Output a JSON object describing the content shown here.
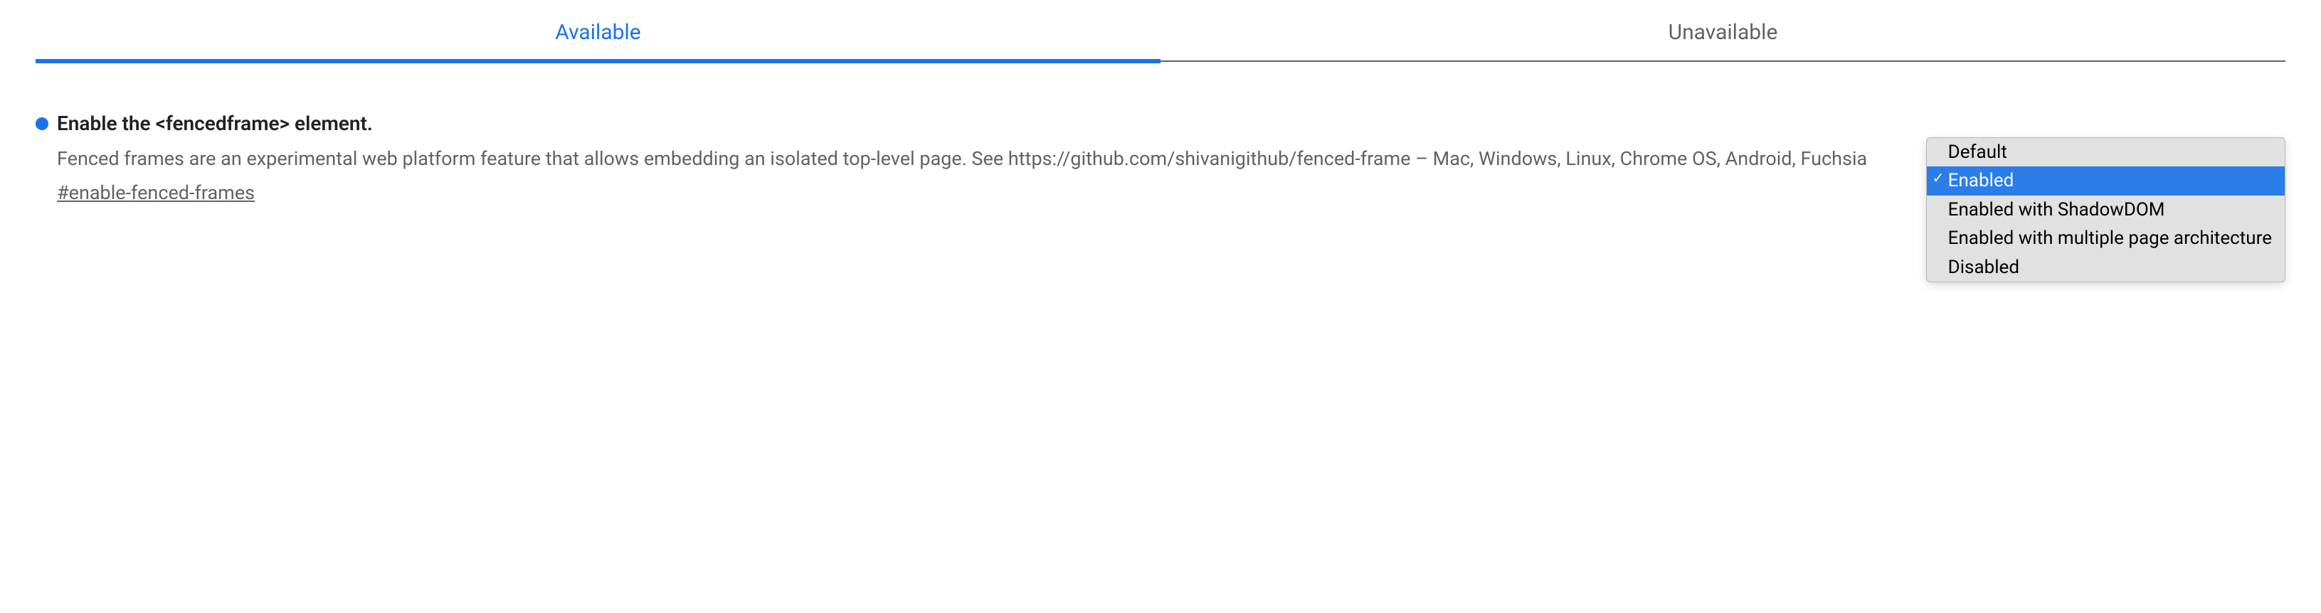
{
  "tabs": {
    "available": "Available",
    "unavailable": "Unavailable"
  },
  "flag": {
    "title": "Enable the <fencedframe> element.",
    "description": "Fenced frames are an experimental web platform feature that allows embedding an isolated top-level page. See https://github.com/shivanigithub/fenced-frame – Mac, Windows, Linux, Chrome OS, Android, Fuchsia",
    "hash": "#enable-fenced-frames"
  },
  "dropdown": {
    "options": {
      "default": "Default",
      "enabled": "Enabled",
      "shadow": "Enabled with ShadowDOM",
      "multi": "Enabled with multiple page architecture",
      "disabled": "Disabled"
    },
    "selected": "Enabled"
  }
}
